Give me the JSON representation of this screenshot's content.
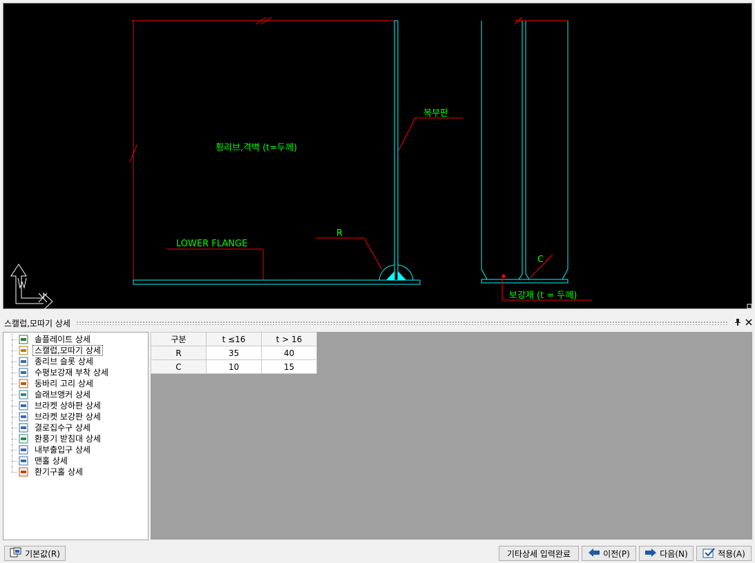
{
  "drawing": {
    "label_rib": "횡리브,격벽 (t=두께)",
    "label_web": "복부판",
    "label_lower_flange": "LOWER FLANGE",
    "label_r": "R",
    "label_c": "C",
    "label_stiffener": "보강재 (t = 두께)",
    "colors": {
      "dimension": "#ff0000",
      "text": "#00ff00",
      "geometry": "#00ffff"
    }
  },
  "panel": {
    "title": "스캘럽,모따기 상세",
    "pin_icon": "pin-icon",
    "close_icon": "close-icon"
  },
  "tree": {
    "items": [
      {
        "label": "솔플레이트 상세",
        "icon": "sole-plate-icon",
        "color": "#3a7a3a"
      },
      {
        "label": "스캘럽,모따기 상세",
        "icon": "scallop-icon",
        "color": "#c08000",
        "selected": true
      },
      {
        "label": "종리브 슬롯 상세",
        "icon": "rib-slot-icon",
        "color": "#3a6ab0"
      },
      {
        "label": "수평보강재 부착 상세",
        "icon": "horizontal-stiffener-icon",
        "color": "#2f6fb0"
      },
      {
        "label": "동바리 고리 상세",
        "icon": "shoring-hook-icon",
        "color": "#c05a00"
      },
      {
        "label": "슬래브앵커 상세",
        "icon": "slab-anchor-icon",
        "color": "#2a8a8a"
      },
      {
        "label": "브라켓 상하판 상세",
        "icon": "bracket-plate-icon",
        "color": "#3a6ab0"
      },
      {
        "label": "브라켓 보강판 상세",
        "icon": "bracket-stiffener-icon",
        "color": "#3a6ab0"
      },
      {
        "label": "결로집수구 상세",
        "icon": "condensation-drain-icon",
        "color": "#3a6ab0"
      },
      {
        "label": "환풍기 받침대 상세",
        "icon": "fan-support-icon",
        "color": "#2a8a5a"
      },
      {
        "label": "내부출입구 상세",
        "icon": "inner-access-icon",
        "color": "#3a6ab0"
      },
      {
        "label": "맨홀 상세",
        "icon": "manhole-icon",
        "color": "#3a6ab0"
      },
      {
        "label": "환기구홀 상세",
        "icon": "vent-hole-icon",
        "color": "#d04000"
      }
    ]
  },
  "grid": {
    "headers": [
      "구분",
      "t ≤16",
      "t > 16"
    ],
    "rows": [
      [
        "R",
        "35",
        "40"
      ],
      [
        "C",
        "10",
        "15"
      ]
    ]
  },
  "footer": {
    "default_label": "기본값(R)",
    "complete_label": "기타상세 입력완료",
    "prev_label": "이전(P)",
    "next_label": "다음(N)",
    "apply_label": "적용(A)"
  }
}
